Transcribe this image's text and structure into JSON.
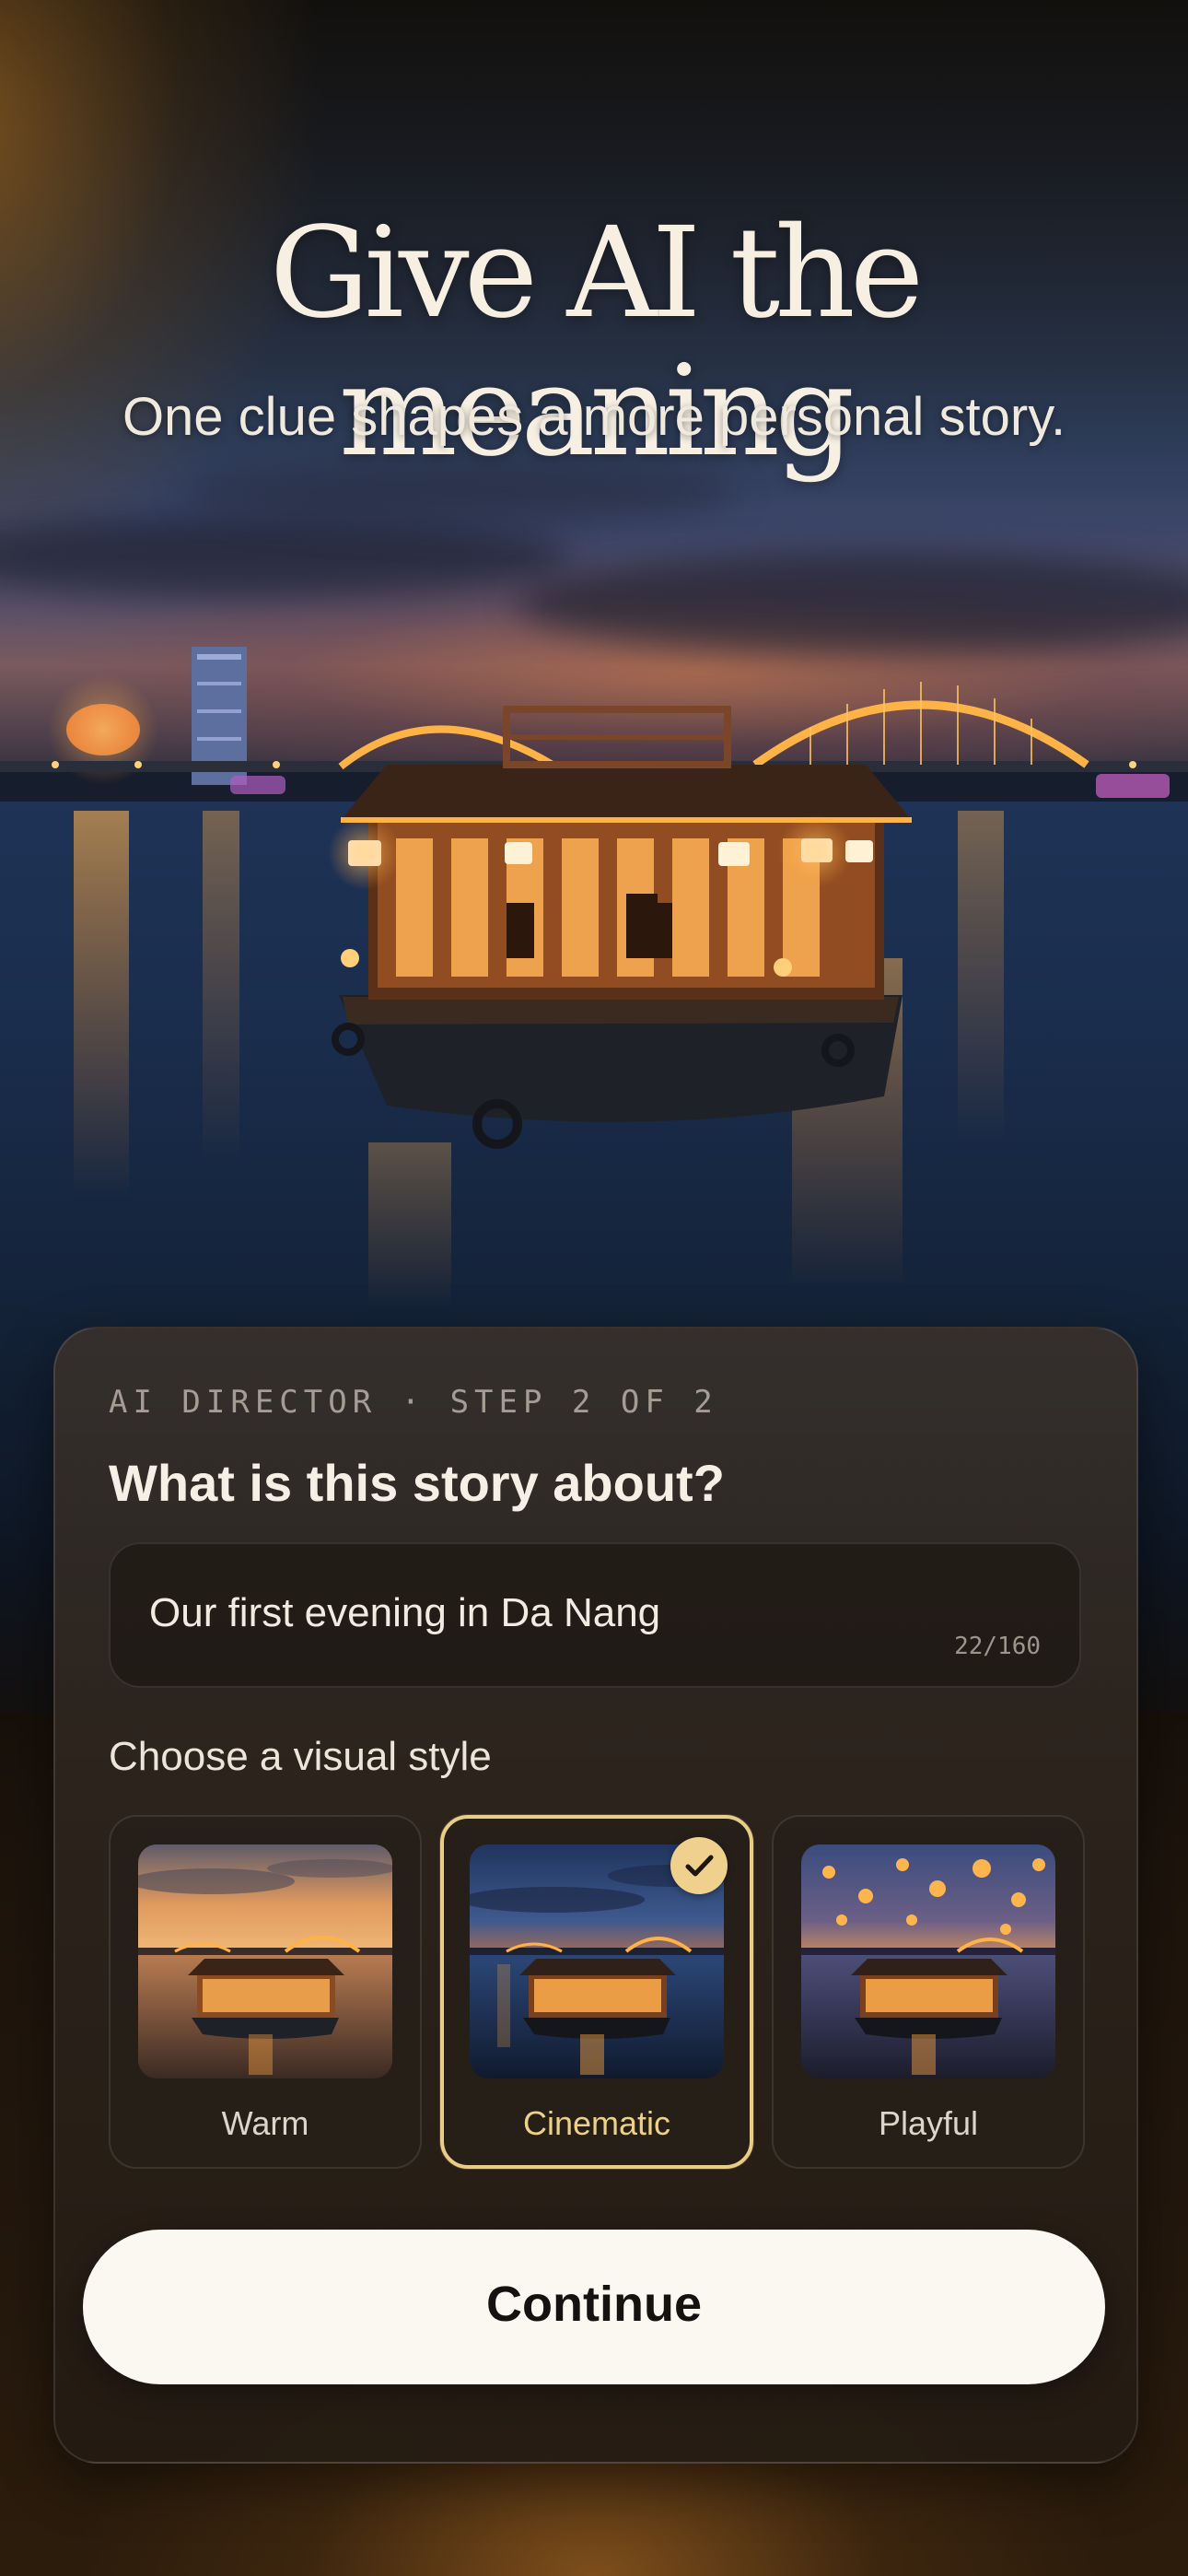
{
  "header": {
    "title": "Give AI the meaning",
    "subtitle": "One clue shapes a more personal story."
  },
  "card": {
    "eyebrow": "AI DIRECTOR · STEP 2 OF 2",
    "question": "What is this story about?",
    "story_input": {
      "value": "Our first evening in Da Nang",
      "char_count": "22/160"
    },
    "style_section_label": "Choose a visual style",
    "styles": [
      {
        "label": "Warm",
        "selected": false
      },
      {
        "label": "Cinematic",
        "selected": true
      },
      {
        "label": "Playful",
        "selected": false
      }
    ]
  },
  "continue_button": {
    "label": "Continue"
  },
  "colors": {
    "accent_gold": "#e8cd86",
    "button_bg": "#fbf8f2",
    "card_bg": "#2c241d"
  }
}
